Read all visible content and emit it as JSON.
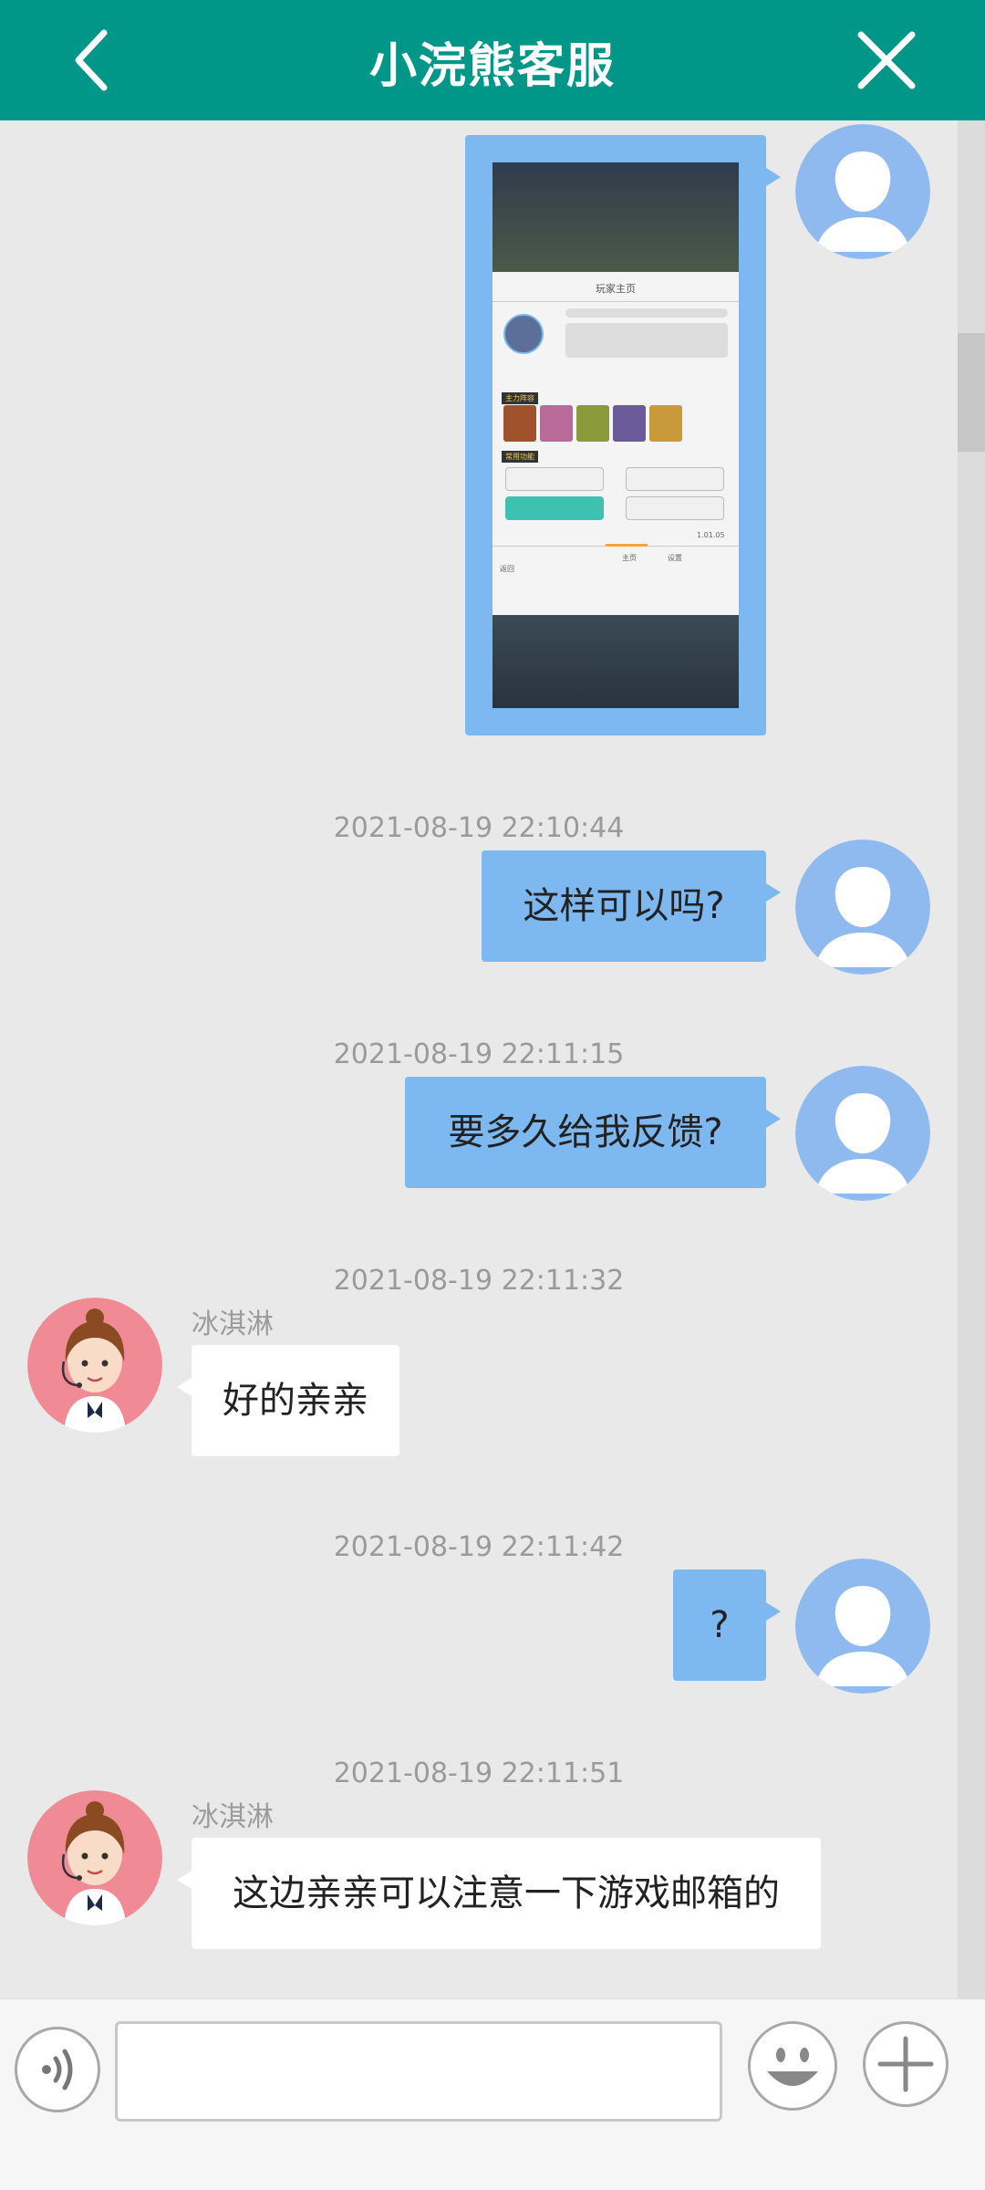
{
  "header": {
    "title": "小浣熊客服",
    "back_icon": "chevron-left-icon",
    "close_icon": "close-icon"
  },
  "colors": {
    "header_bg": "#009688",
    "my_bubble": "#7eb8f0",
    "their_bubble": "#ffffff",
    "background": "#e9e9ea"
  },
  "screenshot_message": {
    "panel_title": "玩家主页",
    "tag_main": "主力阵容",
    "tag_common": "常用功能",
    "version": "1.01.05",
    "tab_home": "主页",
    "tab_settings": "设置",
    "back_label": "返回"
  },
  "messages": [
    {
      "time": "2021-08-19 22:10:44",
      "sender": "me",
      "text": "这样可以吗?"
    },
    {
      "time": "2021-08-19 22:11:15",
      "sender": "me",
      "text": "要多久给我反馈?"
    },
    {
      "time": "2021-08-19 22:11:32",
      "sender": "agent",
      "name": "冰淇淋",
      "text": "好的亲亲"
    },
    {
      "time": "2021-08-19 22:11:42",
      "sender": "me",
      "text": "?"
    },
    {
      "time": "2021-08-19 22:11:51",
      "sender": "agent",
      "name": "冰淇淋",
      "text": "这边亲亲可以注意一下游戏邮箱的"
    }
  ],
  "input": {
    "value": "",
    "placeholder": ""
  },
  "toolbar": {
    "voice_icon": "voice-icon",
    "emoji_icon": "emoji-icon",
    "plus_icon": "plus-icon"
  }
}
